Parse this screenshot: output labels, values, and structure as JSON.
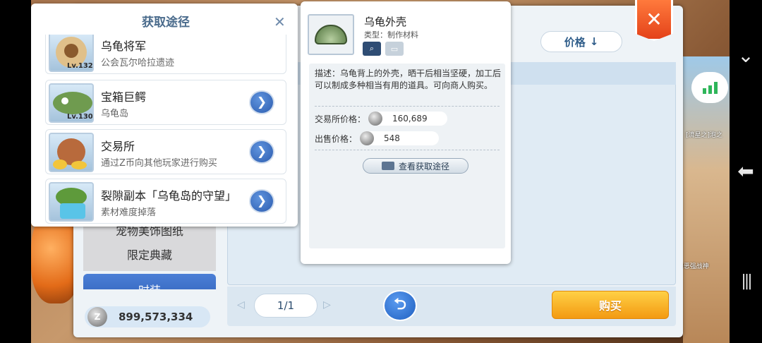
{
  "acquisition": {
    "title": "获取途径",
    "close_icon": "close-x-icon",
    "entries": [
      {
        "name": "乌龟将军",
        "desc": "公会瓦尔哈拉遗迹",
        "level": "Lv.132",
        "icon": "turtle-general-portrait"
      },
      {
        "name": "宝箱巨鳄",
        "desc": "乌龟岛",
        "level": "Lv.130",
        "icon": "chest-crocodile-portrait"
      },
      {
        "name": "交易所",
        "desc": "通过Z币向其他玩家进行购买",
        "level": "",
        "icon": "coin-bag-icon"
      },
      {
        "name": "裂隙副本「乌龟岛的守望」",
        "desc": "素材难度掉落",
        "level": "",
        "icon": "turtle-island-icon"
      }
    ],
    "go_glyph": "❯"
  },
  "item": {
    "name": "乌龟外壳",
    "type": "类型：制作材料",
    "description": "描述：乌龟背上的外壳，晒干后相当坚硬，加工后可以制成多种相当有用的道具。可向商人购买。",
    "exchange_label": "交易所价格：",
    "exchange_price": "160,689",
    "sell_label": "出售价格：",
    "sell_price": "548",
    "view_source_label": "查看获取途径"
  },
  "shop": {
    "sort_label": "价格",
    "sort_arrow": "↓",
    "categories": [
      "宠物美饰图纸",
      "限定典藏",
      "时装"
    ],
    "currency_amount": "899,573,334",
    "page": "1/1",
    "buy_label": "购买",
    "back_glyph": "⮌",
    "prev_glyph": "◁",
    "next_glyph": "▷",
    "close_glyph": "✕"
  },
  "system_nav": {
    "collapse_glyph": "⌄",
    "back_glyph": "⬅",
    "recents_glyph": "|||"
  },
  "scene": {
    "labels": [
      "[流星之]泡之",
      "Ⅰ恶强战神"
    ]
  }
}
